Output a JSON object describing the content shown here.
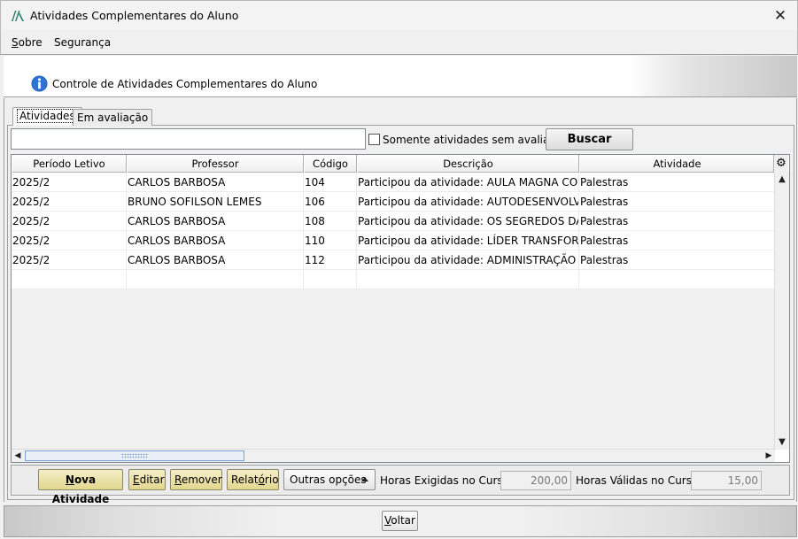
{
  "window": {
    "title": "Atividades Complementares do Aluno",
    "close_glyph": "✕"
  },
  "menu": [
    {
      "prefix": "S",
      "label": "obre"
    },
    {
      "prefix": "",
      "label": "Segurança"
    }
  ],
  "header": {
    "title": "Controle de Atividades Complementares do Aluno"
  },
  "tabs": {
    "active": "Atividades",
    "inactive": "Em avaliação"
  },
  "search": {
    "value": "",
    "placeholder": "",
    "checkbox_label": "Somente atividades sem avaliação",
    "button": "Buscar"
  },
  "grid": {
    "columns": [
      "Período Letivo",
      "Professor",
      "Código",
      "Descrição",
      "Atividade"
    ],
    "rows": [
      [
        "2025/2",
        "CARLOS BARBOSA",
        "104",
        "Participou da atividade: AULA MAGNA COM ...",
        "Palestras"
      ],
      [
        "2025/2",
        "BRUNO SOFILSON LEMES",
        "106",
        "Participou da atividade: AUTODESENVOLVIM...",
        "Palestras"
      ],
      [
        "2025/2",
        "CARLOS BARBOSA",
        "108",
        "Participou da atividade: OS SEGREDOS DA OR...",
        "Palestras"
      ],
      [
        "2025/2",
        "CARLOS BARBOSA",
        "110",
        "Participou da atividade: LÍDER TRANSFORMA...",
        "Palestras"
      ],
      [
        "2025/2",
        "CARLOS BARBOSA",
        "112",
        "Participou da atividade: ADMINISTRAÇÃO PÚ...",
        "Palestras"
      ]
    ]
  },
  "toolbar": {
    "nova_atividade": {
      "u": "N",
      "rest": "ova Atividade"
    },
    "editar": {
      "u": "E",
      "rest": "ditar"
    },
    "remover": {
      "u": "R",
      "rest": "emover"
    },
    "relatorio": {
      "pre": "Relat",
      "u": "ó",
      "rest": "rio"
    },
    "outras_opcoes": "Outras opções",
    "horas_exigidas_label": "Horas Exigidas no Curso:",
    "horas_exigidas_value": "200,00",
    "horas_validas_label": "Horas Válidas no Curso:",
    "horas_validas_value": "15,00"
  },
  "footer": {
    "voltar": {
      "u": "V",
      "rest": "oltar"
    }
  },
  "colors": {
    "accent_button": "#e2d68e",
    "info_icon": "#1f5fbf"
  }
}
